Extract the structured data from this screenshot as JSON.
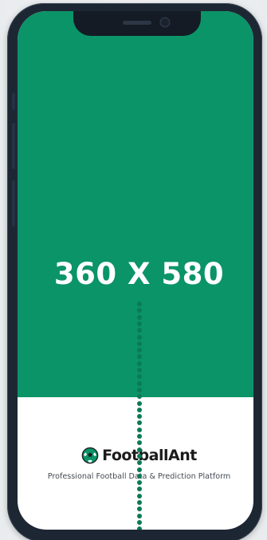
{
  "screen": {
    "size_label": "360 X 580",
    "background_color": "#0a9468",
    "footer_background": "#ffffff",
    "dots_color": "#0b7a56"
  },
  "brand": {
    "icon": "football-icon",
    "name": "FootballAnt",
    "tagline": "Professional Football Data & Prediction Platform"
  }
}
